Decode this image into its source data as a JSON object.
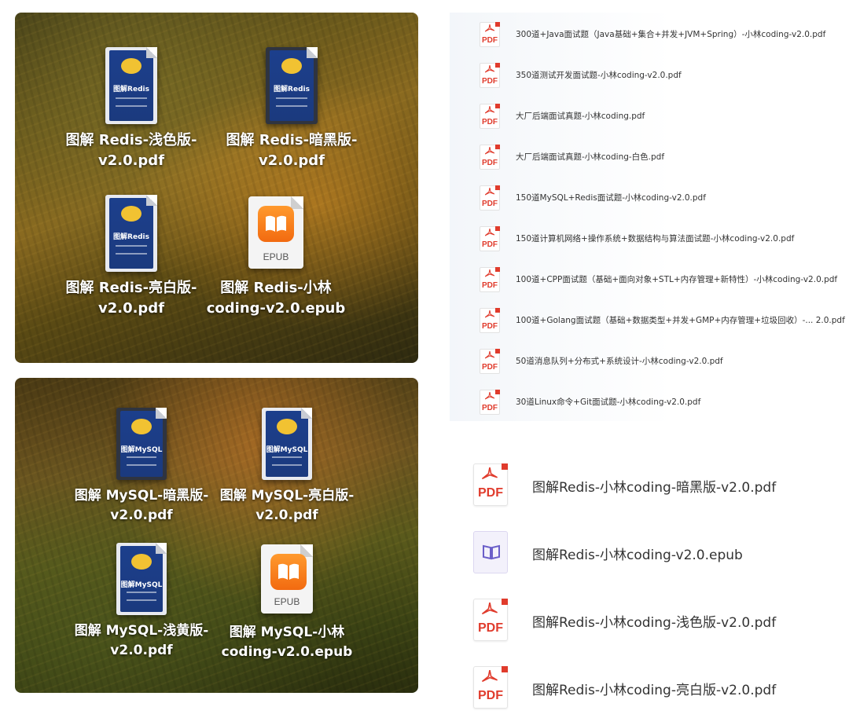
{
  "desktop_redis": {
    "icons": [
      {
        "label_line1": "图解 Redis-浅色版-",
        "label_line2": "v2.0.pdf",
        "kind": "book-light",
        "cover_title": "图解Redis"
      },
      {
        "label_line1": "图解 Redis-暗黑版-",
        "label_line2": "v2.0.pdf",
        "kind": "book-dark",
        "cover_title": "图解Redis"
      },
      {
        "label_line1": "图解 Redis-亮白版-",
        "label_line2": "v2.0.pdf",
        "kind": "book-light",
        "cover_title": "图解Redis"
      },
      {
        "label_line1": "图解 Redis-小林",
        "label_line2": "coding-v2.0.epub",
        "kind": "epub",
        "badge": "EPUB"
      }
    ]
  },
  "desktop_mysql": {
    "icons": [
      {
        "label_line1": "图解 MySQL-暗黑版-",
        "label_line2": "v2.0.pdf",
        "kind": "book-dark",
        "cover_title": "图解MySQL"
      },
      {
        "label_line1": "图解 MySQL-亮白版-",
        "label_line2": "v2.0.pdf",
        "kind": "book-light",
        "cover_title": "图解MySQL"
      },
      {
        "label_line1": "图解 MySQL-浅黄版-",
        "label_line2": "v2.0.pdf",
        "kind": "book-light",
        "cover_title": "图解MySQL"
      },
      {
        "label_line1": "图解 MySQL-小林",
        "label_line2": "coding-v2.0.epub",
        "kind": "epub",
        "badge": "EPUB"
      }
    ]
  },
  "small_list": {
    "icon_text": "PDF",
    "files": [
      "300道+Java面试题（Java基础+集合+并发+JVM+Spring）-小林coding-v2.0.pdf",
      "350道测试开发面试题-小林coding-v2.0.pdf",
      "大厂后端面试真题-小林coding.pdf",
      "大厂后端面试真题-小林coding-白色.pdf",
      "150道MySQL+Redis面试题-小林coding-v2.0.pdf",
      "150道计算机网络+操作系统+数据结构与算法面试题-小林coding-v2.0.pdf",
      "100道+CPP面试题（基础+面向对象+STL+内存管理+新特性）-小林coding-v2.0.pdf",
      "100道+Golang面试题（基础+数据类型+并发+GMP+内存管理+垃圾回收）-... 2.0.pdf",
      "50道消息队列+分布式+系统设计-小林coding-v2.0.pdf",
      "30道Linux命令+Git面试题-小林coding-v2.0.pdf"
    ]
  },
  "large_list": {
    "icon_text": "PDF",
    "files": [
      {
        "name": "图解Redis-小林coding-暗黑版-v2.0.pdf",
        "kind": "pdf"
      },
      {
        "name": "图解Redis-小林coding-v2.0.epub",
        "kind": "epub"
      },
      {
        "name": "图解Redis-小林coding-浅色版-v2.0.pdf",
        "kind": "pdf"
      },
      {
        "name": "图解Redis-小林coding-亮白版-v2.0.pdf",
        "kind": "pdf"
      }
    ]
  },
  "colors": {
    "pdf_red": "#e03b2c",
    "epub_orange": "#f26a10",
    "book_blue": "#1c3f8c",
    "epub_purple": "#6b5fc9"
  }
}
